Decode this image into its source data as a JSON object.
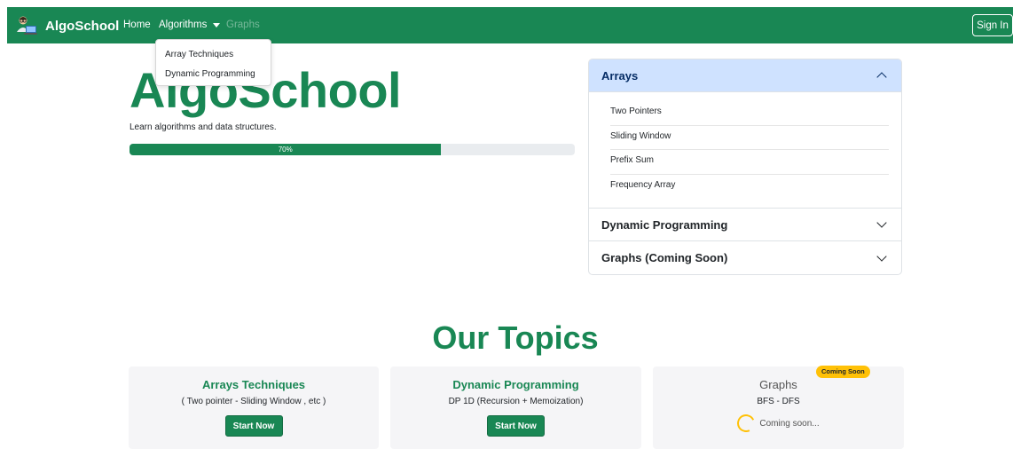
{
  "navbar": {
    "brand": "AlgoSchool",
    "logo_icon": "student-laptop-icon",
    "links": {
      "home": "Home",
      "algorithms": "Algorithms",
      "graphs": "Graphs"
    },
    "signin": "Sign In",
    "colors": {
      "bg": "#198754"
    }
  },
  "dropdown": {
    "items": [
      "Array Techniques",
      "Dynamic Programming"
    ]
  },
  "hero": {
    "title": "AlgoSchool",
    "subtitle": "Learn algorithms and data structures.",
    "progress": {
      "value": 70,
      "label": "70%"
    }
  },
  "accordion": {
    "sections": [
      {
        "title": "Arrays",
        "open": true,
        "items": [
          "Two Pointers",
          "Sliding Window",
          "Prefix Sum",
          "Frequency Array"
        ]
      },
      {
        "title": "Dynamic Programming",
        "open": false
      },
      {
        "title": "Graphs (Coming Soon)",
        "open": false
      }
    ]
  },
  "topics": {
    "title": "Our Topics",
    "cards": [
      {
        "title": "Arrays Techniques",
        "desc": "( Two pointer - Sliding Window , etc )",
        "button": "Start Now"
      },
      {
        "title": "Dynamic Programming",
        "desc": "DP 1D (Recursion + Memoization)",
        "button": "Start Now"
      },
      {
        "title": "Graphs",
        "desc": "BFS - DFS",
        "badge": "Coming Soon",
        "status": "Coming soon..."
      }
    ]
  },
  "colors": {
    "accent": "#198754",
    "accordion_open_bg": "#cfe2ff",
    "badge": "#ffc107"
  }
}
